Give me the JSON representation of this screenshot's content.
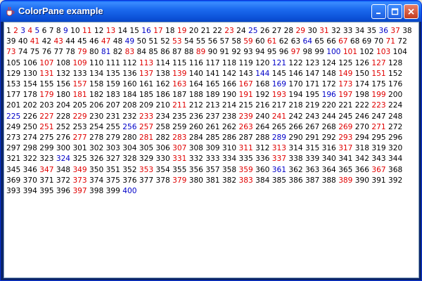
{
  "window": {
    "title": "ColorPane example",
    "icon": "java-coffee-cup-icon",
    "buttons": {
      "minimize": "minimize-icon",
      "maximize": "maximize-icon",
      "close": "close-icon"
    }
  },
  "colors": {
    "default": "#000000",
    "red": "#E00000",
    "blue": "#0000C8"
  },
  "numbers": {
    "start": 1,
    "end": 400,
    "red": [
      2,
      4,
      11,
      13,
      17,
      19,
      23,
      29,
      31,
      37,
      41,
      43,
      47,
      53,
      59,
      61,
      67,
      71,
      73,
      79,
      83,
      89,
      97,
      101,
      103,
      107,
      109,
      113,
      127,
      131,
      137,
      139,
      149,
      151,
      157,
      163,
      167,
      173,
      179,
      181,
      191,
      193,
      197,
      199,
      211,
      223,
      227,
      229,
      233,
      239,
      241,
      251,
      257,
      263,
      269,
      271,
      277,
      281,
      283,
      293,
      307,
      311,
      313,
      317,
      331,
      337,
      347,
      349,
      353,
      359,
      367,
      373,
      379,
      383,
      389,
      397
    ],
    "blue": [
      3,
      5,
      9,
      16,
      25,
      36,
      49,
      64,
      81,
      100,
      121,
      144,
      169,
      196,
      225,
      256,
      289,
      324,
      361,
      400
    ]
  }
}
